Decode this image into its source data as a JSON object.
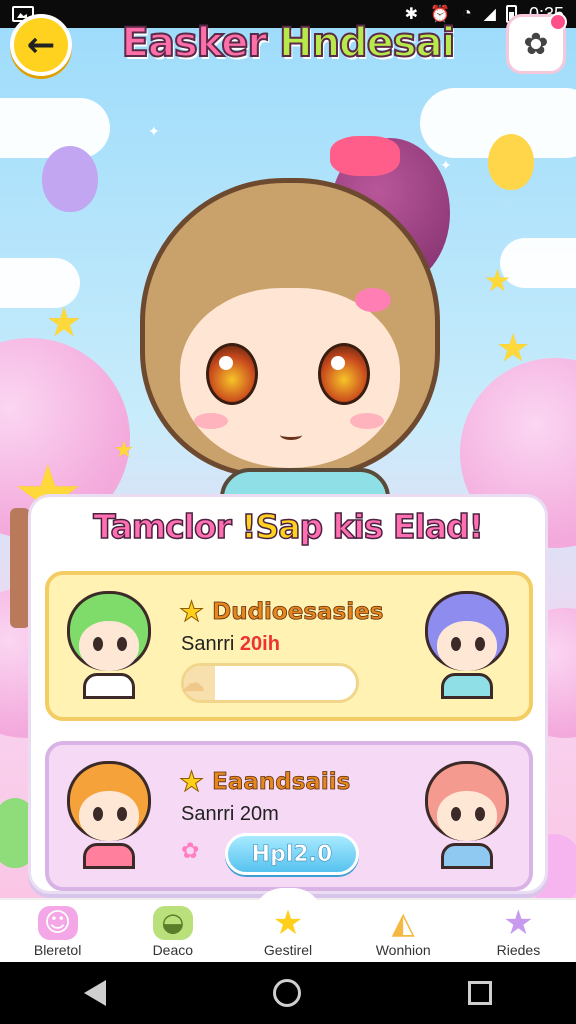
{
  "status_bar": {
    "time": "0:35",
    "icons": [
      "gallery-icon",
      "bluetooth-icon",
      "alarm-icon",
      "wifi-icon",
      "signal-icon",
      "battery-icon"
    ]
  },
  "header": {
    "title_a": "Easker ",
    "title_b": "Hndesai"
  },
  "panel": {
    "title_a": "Tamclor ",
    "title_b": "!Sa",
    "title_c": "p kis Elad!"
  },
  "cards": [
    {
      "name": "Dudioesasies",
      "subtitle_prefix": "Sanrri ",
      "subtitle_highlight": "20ih",
      "progress": 0.18
    },
    {
      "name": "Eaandsaiis",
      "subtitle_prefix": "Sanrri 20m",
      "button_label": "Hpl2.0"
    }
  ],
  "tabs": [
    {
      "label": "Bleretol",
      "icon": "ghost-icon"
    },
    {
      "label": "Deaco",
      "icon": "turtle-icon"
    },
    {
      "label": "Gestirel",
      "icon": "star-icon"
    },
    {
      "label": "Wonhion",
      "icon": "cake-icon"
    },
    {
      "label": "Riedes",
      "icon": "star-icon"
    }
  ],
  "colors": {
    "accent_pink": "#ff6fb2",
    "accent_yellow": "#ffd21f",
    "card1_bg": "#fff2b3",
    "card2_bg": "#f6d9f4",
    "button_blue": "#56c2ef"
  }
}
